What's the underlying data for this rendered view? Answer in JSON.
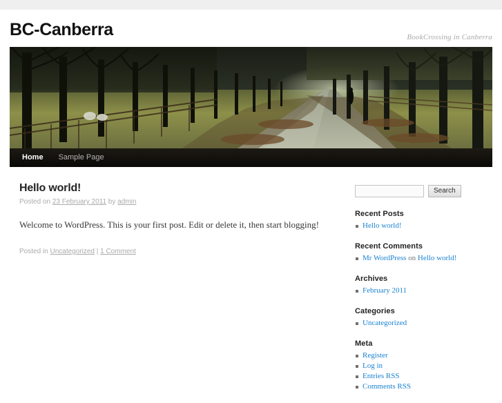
{
  "site": {
    "title": "BC-Canberra",
    "description": "BookCrossing in Canberra",
    "header_image_alt": "tree-lined-path-header"
  },
  "nav": {
    "items": [
      {
        "label": "Home",
        "current": true
      },
      {
        "label": "Sample Page",
        "current": false
      }
    ]
  },
  "post": {
    "title": "Hello world!",
    "meta_prefix": "Posted on ",
    "date": "23 February 2011",
    "meta_by": " by ",
    "author": "admin",
    "body": "Welcome to WordPress. This is your first post. Edit or delete it, then start blogging!",
    "footer_prefix": "Posted in ",
    "category": "Uncategorized",
    "footer_separator": " | ",
    "comments": "1 Comment"
  },
  "search": {
    "value": "",
    "placeholder": "",
    "button_label": "Search"
  },
  "sidebar": {
    "widgets": [
      {
        "title": "Recent Posts",
        "items": [
          {
            "text": "Hello world!",
            "link": true
          }
        ]
      },
      {
        "title": "Recent Comments",
        "items": [
          {
            "text": "Mr WordPress",
            "link": true,
            "middle": " on ",
            "text2": "Hello world!",
            "link2": true
          }
        ]
      },
      {
        "title": "Archives",
        "items": [
          {
            "text": "February 2011",
            "link": true
          }
        ]
      },
      {
        "title": "Categories",
        "items": [
          {
            "text": "Uncategorized",
            "link": true
          }
        ]
      },
      {
        "title": "Meta",
        "items": [
          {
            "text": "Register",
            "link": true
          },
          {
            "text": "Log in",
            "link": true
          },
          {
            "text": "Entries RSS",
            "link": true
          },
          {
            "text": "Comments RSS",
            "link": true
          }
        ]
      }
    ]
  },
  "colors": {
    "link": "#1982d1",
    "nav_background": "#13110c",
    "top_strip": "#efefef",
    "text": "#373737",
    "muted": "#aaaaaa"
  }
}
